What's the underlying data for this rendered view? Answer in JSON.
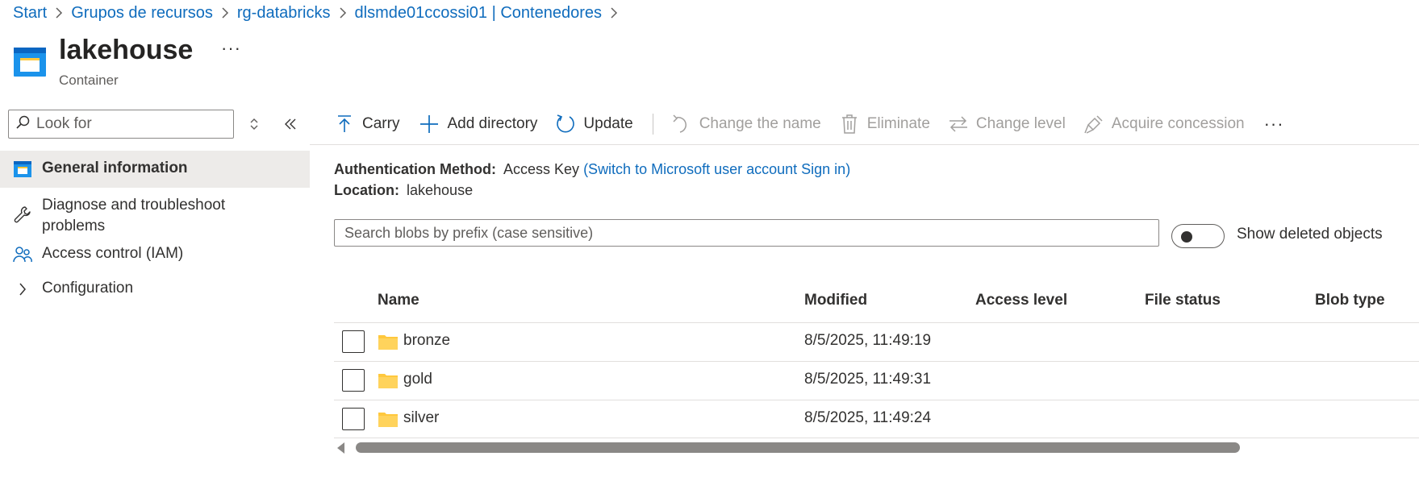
{
  "breadcrumb": [
    "Start",
    "Grupos de recursos",
    "rg-databricks",
    "dlsmde01ccossi01 | Contenedores"
  ],
  "header": {
    "title": "lakehouse",
    "subtitle": "Container",
    "more": "···"
  },
  "sidebar": {
    "search_placeholder": "Look for",
    "items": [
      {
        "label": "General information",
        "icon": "container-icon",
        "active": true
      },
      {
        "label": "Diagnose and troubleshoot problems",
        "icon": "wrench-icon"
      },
      {
        "label": "Access control (IAM)",
        "icon": "people-icon"
      },
      {
        "label": "Configuration",
        "icon": "chevron-right-icon"
      }
    ]
  },
  "toolbar": {
    "upload": "Carry",
    "add_directory": "Add directory",
    "refresh": "Update",
    "rename": "Change the name",
    "delete": "Eliminate",
    "change_tier": "Change level",
    "acquire_lease": "Acquire concession",
    "more": "···"
  },
  "info": {
    "auth_label": "Authentication Method:",
    "auth_value": "Access Key",
    "auth_link": "(Switch to Microsoft user account Sign in)",
    "location_label": "Location:",
    "location_value": "lakehouse"
  },
  "blob_search": {
    "placeholder": "Search blobs by prefix (case sensitive)"
  },
  "show_deleted": {
    "label": "Show deleted objects",
    "on": false
  },
  "table": {
    "columns": [
      "Name",
      "Modified",
      "Access level",
      "File status",
      "Blob type"
    ],
    "rows": [
      {
        "name": "bronze",
        "modified": "8/5/2025, 11:49:19"
      },
      {
        "name": "gold",
        "modified": "8/5/2025, 11:49:31"
      },
      {
        "name": "silver",
        "modified": "8/5/2025, 11:49:24"
      }
    ]
  },
  "colors": {
    "accent": "#0f6cbd",
    "folder": "#ffc83d",
    "active_bg": "#edebe9"
  }
}
